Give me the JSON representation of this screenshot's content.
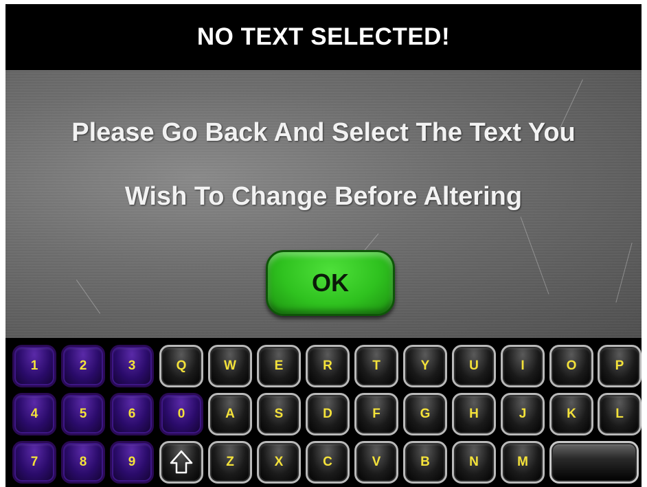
{
  "titlebar": {
    "title": "NO TEXT SELECTED!"
  },
  "message": {
    "line1": "Please Go Back And Select The Text You",
    "line2": "Wish To Change Before Altering"
  },
  "ok_button": {
    "label": "OK",
    "color": "#2fc21f"
  },
  "keyboard": {
    "key_text_color": "#f4e23a",
    "number_key_color": "#2a0b6a",
    "rows": [
      [
        "1",
        "2",
        "3",
        "Q",
        "W",
        "E",
        "R",
        "T",
        "Y",
        "U",
        "I",
        "O",
        "P"
      ],
      [
        "4",
        "5",
        "6",
        "0",
        "A",
        "S",
        "D",
        "F",
        "G",
        "H",
        "J",
        "K",
        "L"
      ],
      [
        "7",
        "8",
        "9",
        "shift-icon",
        "Z",
        "X",
        "C",
        "V",
        "B",
        "N",
        "M",
        "space-key"
      ]
    ]
  }
}
